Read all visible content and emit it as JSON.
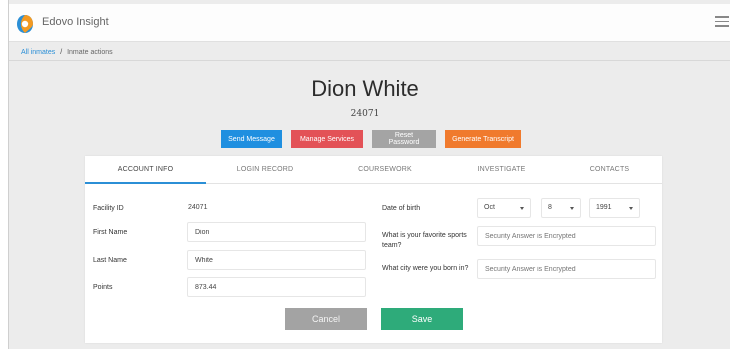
{
  "app": {
    "title": "Edovo Insight",
    "logo_icon": "edovo-logo-icon",
    "menu_icon": "hamburger-menu-icon"
  },
  "breadcrumb": {
    "parent": "All inmates",
    "separator": "/",
    "current": "Inmate actions"
  },
  "inmate": {
    "name": "Dion White",
    "id": "24071"
  },
  "actions": {
    "send_message": "Send Message",
    "manage_services": "Manage Services",
    "reset_password": "Reset Password",
    "generate_transcript": "Generate Transcript"
  },
  "tabs": [
    {
      "label": "ACCOUNT INFO",
      "active": true
    },
    {
      "label": "LOGIN RECORD",
      "active": false
    },
    {
      "label": "COURSEWORK",
      "active": false
    },
    {
      "label": "INVESTIGATE",
      "active": false
    },
    {
      "label": "CONTACTS",
      "active": false
    }
  ],
  "account": {
    "facility_id_label": "Facility ID",
    "facility_id": "24071",
    "first_name_label": "First Name",
    "first_name": "Dion",
    "last_name_label": "Last Name",
    "last_name": "White",
    "points_label": "Points",
    "points": "873.44",
    "dob_label": "Date of birth",
    "dob_month": "Oct",
    "dob_day": "8",
    "dob_year": "1991",
    "question1_label": "What is your favorite sports team?",
    "question1_answer": "Security Answer is Encrypted",
    "question2_label": "What city were you born in?",
    "question2_answer": "Security Answer is Encrypted"
  },
  "form_buttons": {
    "cancel": "Cancel",
    "save": "Save"
  },
  "colors": {
    "accent": "#2b8fd6",
    "send_message": "#1f8fe0",
    "manage_services": "#e35257",
    "reset_password": "#a4a4a4",
    "generate_transcript": "#f07a2d",
    "save": "#2eab7a",
    "cancel": "#a3a3a3"
  }
}
